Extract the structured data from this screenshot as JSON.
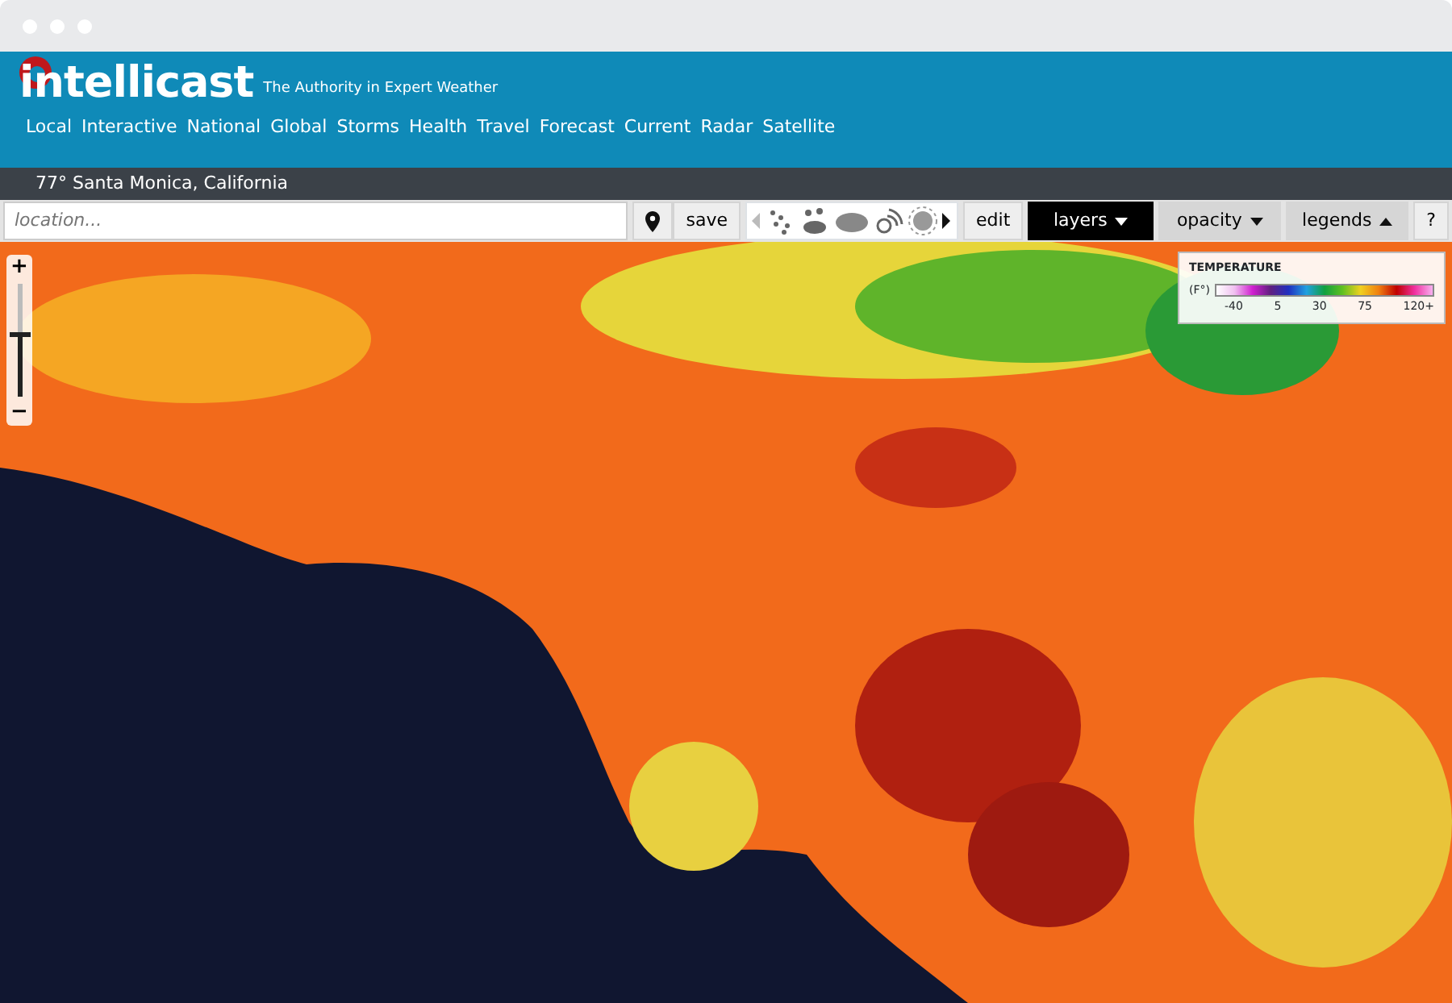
{
  "brand": {
    "name": "intellicast",
    "tagline": "The Authority in Expert Weather"
  },
  "nav": [
    "Local",
    "Interactive",
    "National",
    "Global",
    "Storms",
    "Health",
    "Travel",
    "Forecast",
    "Current",
    "Radar",
    "Satellite"
  ],
  "location_bar": "77° Santa Monica, California",
  "toolbar": {
    "search": {
      "placeholder": "location..."
    },
    "save": "save",
    "edit": "edit",
    "help": "?",
    "dropdowns": [
      {
        "label": "layers",
        "selected": true,
        "expanded": false
      },
      {
        "label": "opacity",
        "selected": false,
        "expanded": false
      },
      {
        "label": "legends",
        "selected": false,
        "expanded": true
      }
    ]
  },
  "zoom": {
    "zoom_in": "+",
    "zoom_out": "−",
    "level": 0.55
  },
  "legend": {
    "title": "TEMPERATURE",
    "unit": "(F°)",
    "ticks": [
      "-40",
      "5",
      "30",
      "75",
      "120+"
    ]
  }
}
